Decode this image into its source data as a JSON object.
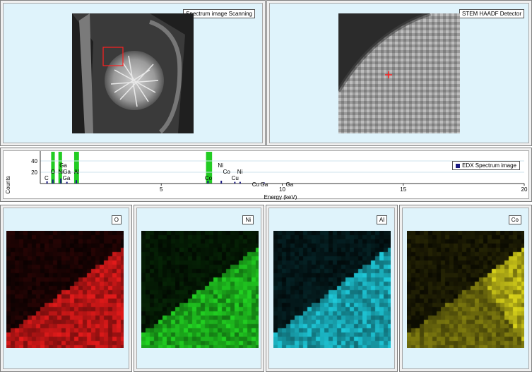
{
  "top_left": {
    "label": "Spectrum image Scanning"
  },
  "top_right": {
    "label": "STEM HAADF Detector"
  },
  "spectrum": {
    "legend": "EDX Spectrum image",
    "chart_data": {
      "type": "bar",
      "title": "",
      "xlabel": "Energy (keV)",
      "ylabel": "Counts",
      "xlim": [
        0,
        20
      ],
      "ylim": [
        0,
        50
      ],
      "xticks": [
        5,
        10,
        15,
        20
      ],
      "yticks": [
        20,
        40
      ],
      "highlight_regions": [
        {
          "x0": 0.45,
          "x1": 0.6
        },
        {
          "x0": 0.75,
          "x1": 0.9
        },
        {
          "x0": 1.4,
          "x1": 1.6
        },
        {
          "x0": 6.85,
          "x1": 7.1
        }
      ],
      "peaks": [
        {
          "x": 0.28,
          "y": 4
        },
        {
          "x": 0.52,
          "y": 7
        },
        {
          "x": 0.85,
          "y": 9
        },
        {
          "x": 1.1,
          "y": 3
        },
        {
          "x": 1.49,
          "y": 6
        },
        {
          "x": 6.93,
          "y": 5
        },
        {
          "x": 7.48,
          "y": 5
        },
        {
          "x": 8.04,
          "y": 3
        },
        {
          "x": 8.26,
          "y": 3
        },
        {
          "x": 9.25,
          "y": 2
        }
      ],
      "element_labels": [
        {
          "text": "C",
          "x": 0.26,
          "row": 3
        },
        {
          "text": "O",
          "x": 0.52,
          "row": 2
        },
        {
          "text": "Ga",
          "x": 0.95,
          "row": 1
        },
        {
          "text": "Ni",
          "x": 0.85,
          "row": 2
        },
        {
          "text": "Ga",
          "x": 1.1,
          "row": 2
        },
        {
          "text": "Ga",
          "x": 1.08,
          "row": 3
        },
        {
          "text": "Al",
          "x": 1.5,
          "row": 2
        },
        {
          "text": "Co",
          "x": 6.95,
          "row": 3
        },
        {
          "text": "Ni",
          "x": 7.45,
          "row": 1
        },
        {
          "text": "Co",
          "x": 7.7,
          "row": 2
        },
        {
          "text": "Cu",
          "x": 8.05,
          "row": 3
        },
        {
          "text": "Ni",
          "x": 8.25,
          "row": 2
        },
        {
          "text": "Cu",
          "x": 8.9,
          "row": 4
        },
        {
          "text": "Ga",
          "x": 9.25,
          "row": 4
        },
        {
          "text": "Ga",
          "x": 10.3,
          "row": 4
        }
      ]
    }
  },
  "maps": [
    {
      "label": "O",
      "color": "#e31a1a"
    },
    {
      "label": "Ni",
      "color": "#22d422"
    },
    {
      "label": "Al",
      "color": "#1ec8d8"
    },
    {
      "label": "Co",
      "color": "#d8d21a"
    }
  ],
  "colors": {
    "panel_bg": "#dff3fb",
    "highlight": "#22cc22",
    "marker": "#ff2020"
  }
}
